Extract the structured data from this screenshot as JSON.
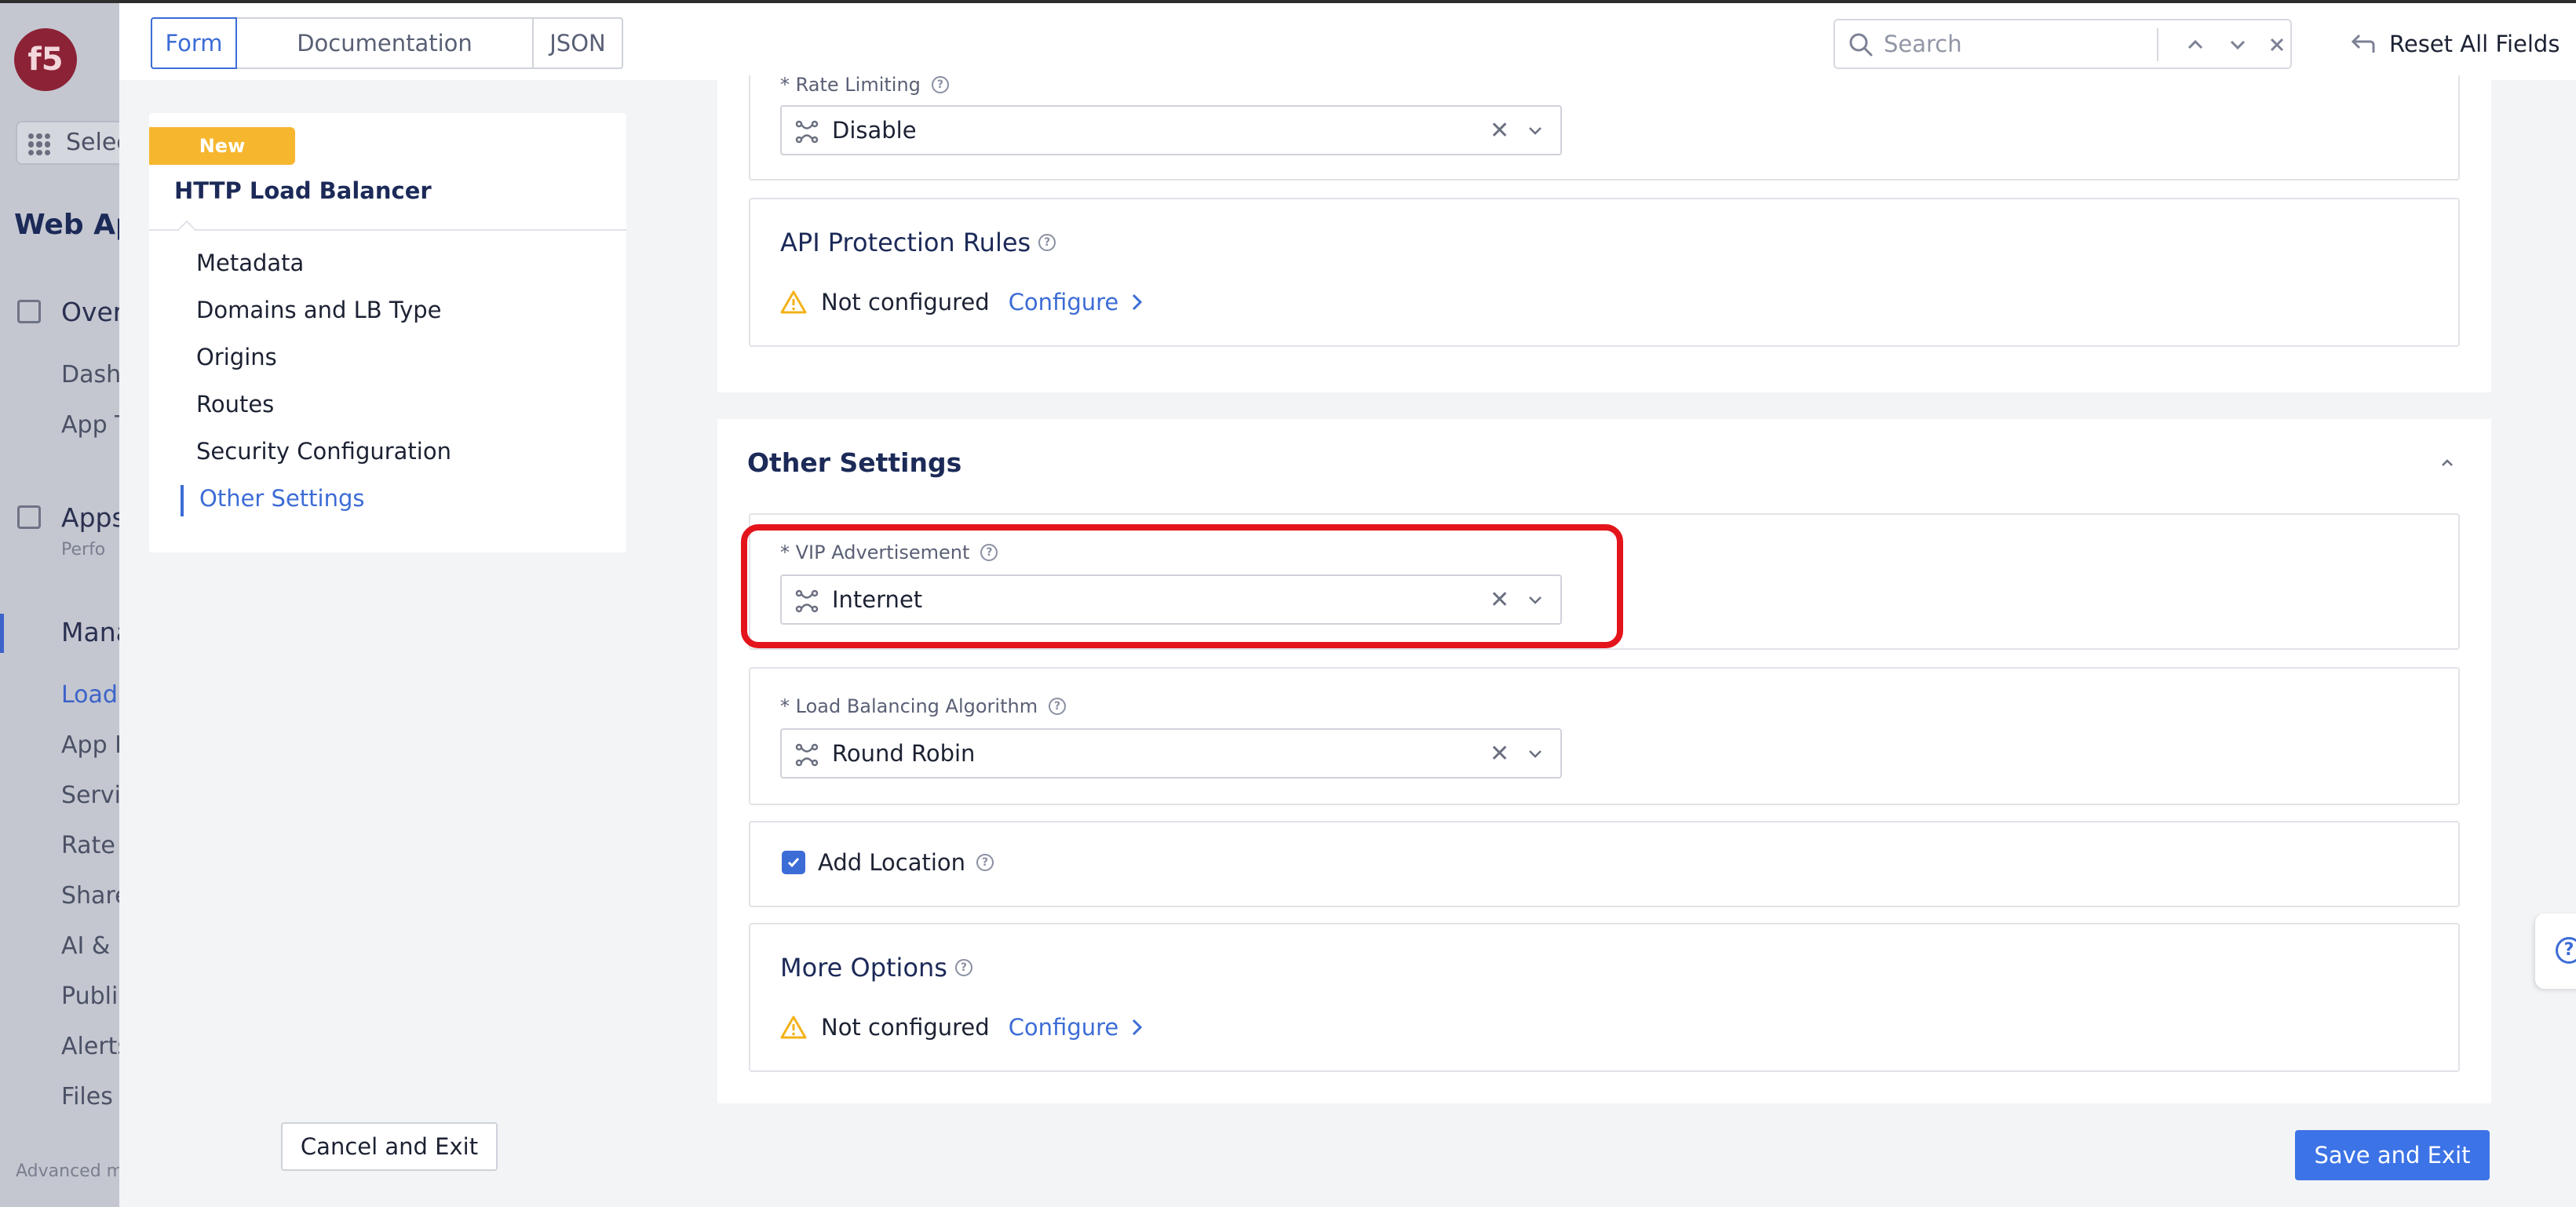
{
  "background_nav": {
    "logo_text": "f5",
    "select_label": "Select",
    "app_title": "Web App",
    "overview_label": "Overview",
    "dashboards_label": "Dashboards",
    "app_t_label": "App T",
    "apps_label": "Apps",
    "apps_sub_label": "Perfo",
    "manage_label": "Manage",
    "items": [
      "Load",
      "App F",
      "Servic",
      "Rate L",
      "Share",
      "AI & M",
      "Public",
      "Alerts",
      "Files"
    ],
    "advanced_label": "Advanced m"
  },
  "topbar": {
    "tabs": [
      "Form",
      "Documentation",
      "JSON"
    ],
    "active_tab": "Form",
    "search_placeholder": "Search",
    "reset_label": "Reset All Fields"
  },
  "side_nav": {
    "badge": "New",
    "title": "HTTP Load Balancer",
    "items": [
      "Metadata",
      "Domains and LB Type",
      "Origins",
      "Routes",
      "Security Configuration",
      "Other Settings"
    ],
    "active_item": "Other Settings"
  },
  "form": {
    "rate_limiting": {
      "label": "* Rate Limiting",
      "value": "Disable"
    },
    "api_protection": {
      "title": "API Protection Rules",
      "status": "Not configured",
      "action": "Configure"
    },
    "other_settings": {
      "title": "Other Settings",
      "vip_advertisement": {
        "label": "* VIP Advertisement",
        "value": "Internet"
      },
      "load_balancing_algorithm": {
        "label": "* Load Balancing Algorithm",
        "value": "Round Robin"
      },
      "add_location": {
        "label": "Add Location",
        "checked": true
      },
      "more_options": {
        "title": "More Options",
        "status": "Not configured",
        "action": "Configure"
      }
    }
  },
  "footer": {
    "cancel_label": "Cancel and Exit",
    "save_label": "Save and Exit"
  },
  "colors": {
    "accent": "#3c6cd6",
    "badge": "#f6b62e",
    "highlight": "#e3141b",
    "warning": "#f3b21a"
  }
}
